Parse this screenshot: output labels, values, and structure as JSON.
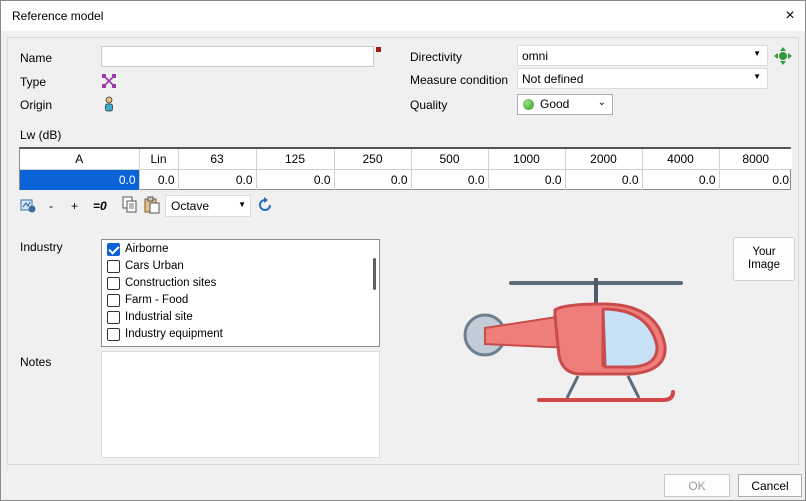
{
  "window": {
    "title": "Reference model",
    "close_icon": "×"
  },
  "form": {
    "name_label": "Name",
    "name_value": "",
    "type_label": "Type",
    "origin_label": "Origin",
    "directivity_label": "Directivity",
    "directivity_value": "omni",
    "measure_condition_label": "Measure condition",
    "measure_condition_value": "Not defined",
    "quality_label": "Quality",
    "quality_value": "Good",
    "quality_color": "#3aa52b",
    "required_color": "#9b1b1b"
  },
  "lw": {
    "label": "Lw (dB)",
    "headers": [
      "A",
      "Lin",
      "63",
      "125",
      "250",
      "500",
      "1000",
      "2000",
      "4000",
      "8000"
    ],
    "values": [
      "0.0",
      "0.0",
      "0.0",
      "0.0",
      "0.0",
      "0.0",
      "0.0",
      "0.0",
      "0.0",
      "0.0"
    ],
    "selected_color": "#0a64d8"
  },
  "toolbar": {
    "minus": "-",
    "plus": "+",
    "zero": "=0",
    "band_value": "Octave"
  },
  "industry": {
    "label": "Industry",
    "items": [
      {
        "label": "Airborne",
        "checked": true
      },
      {
        "label": "Cars Urban",
        "checked": false
      },
      {
        "label": "Construction sites",
        "checked": false
      },
      {
        "label": "Farm - Food",
        "checked": false
      },
      {
        "label": "Industrial site",
        "checked": false
      },
      {
        "label": "Industry equipment",
        "checked": false
      }
    ]
  },
  "notes": {
    "label": "Notes",
    "value": ""
  },
  "image": {
    "button_line1": "Your",
    "button_line2": "Image"
  },
  "footer": {
    "ok": "OK",
    "cancel": "Cancel"
  }
}
